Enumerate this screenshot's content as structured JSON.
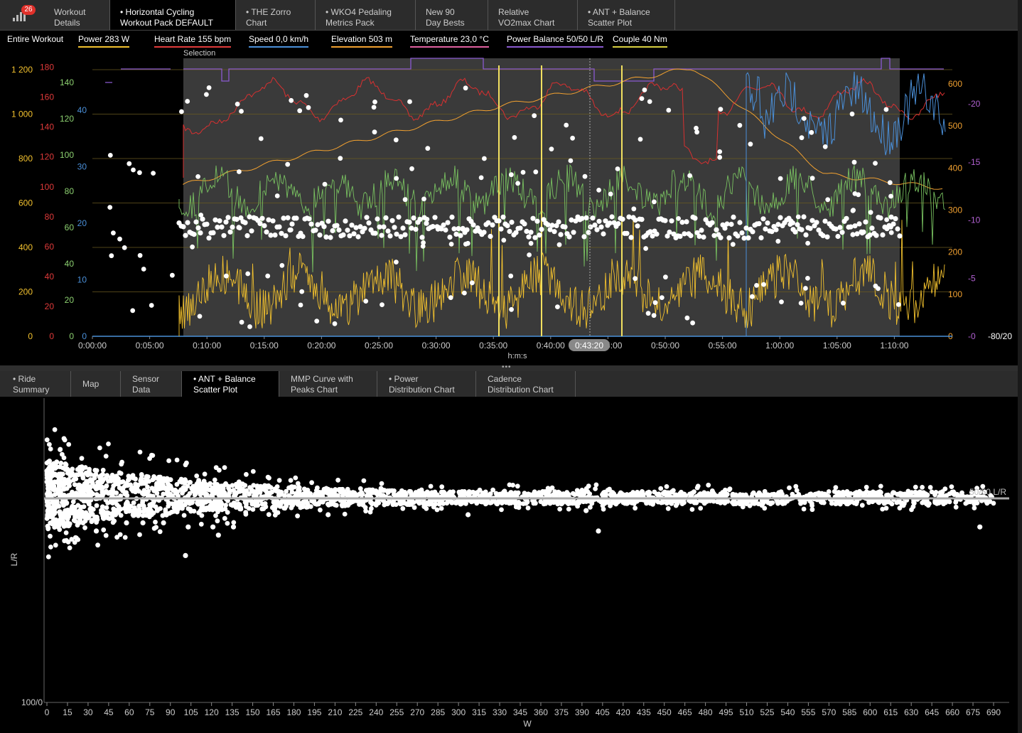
{
  "badge_count": "26",
  "top_tabs": [
    {
      "label": "Workout\nDetails",
      "l1": "Workout",
      "l2": "Details",
      "active": false
    },
    {
      "l1": "• Horizontal Cycling",
      "l2": "Workout Pack DEFAULT",
      "active": true
    },
    {
      "l1": "• THE Zorro",
      "l2": "Chart",
      "active": false
    },
    {
      "l1": "• WKO4 Pedaling",
      "l2": "Metrics Pack",
      "active": false
    },
    {
      "l1": "New 90",
      "l2": "Day Bests",
      "active": false
    },
    {
      "l1": "Relative",
      "l2": "VO2max Chart",
      "active": false
    },
    {
      "l1": "• ANT + Balance",
      "l2": "Scatter Plot",
      "active": false
    }
  ],
  "metrics": {
    "range_label": "Entire Workout",
    "power": "Power  283 W",
    "heart_rate": "Heart Rate  155 bpm",
    "speed": "Speed  0,0 km/h",
    "elevation": "Elevation  503 m",
    "temperature": "Temperature  23,0 °C",
    "power_balance": "Power Balance  50/50 L/R",
    "couple": "Couple  40 Nm"
  },
  "colors": {
    "power": "#f2c12e",
    "heart_rate": "#e03a3a",
    "speed": "#4a8fd8",
    "elevation": "#f0a030",
    "temperature": "#e060a0",
    "power_balance": "#8a5ad0",
    "couple": "#8cd070",
    "selection": "#3a3a3a"
  },
  "top_chart": {
    "selection_label": "Selection",
    "cursor_time": "0:43:20",
    "xlabel": "h:m:s",
    "x_ticks": [
      "0:00:00",
      "0:05:00",
      "0:10:00",
      "0:15:00",
      "0:20:00",
      "0:25:00",
      "0:30:00",
      "0:35:00",
      "0:40:00",
      "0:45:00",
      "0:50:00",
      "0:55:00",
      "1:00:00",
      "1:05:00",
      "1:10:00"
    ],
    "axis_power_ticks": [
      "0",
      "200",
      "400",
      "600",
      "800",
      "1 000",
      "1 200"
    ],
    "axis_hr_ticks": [
      "0",
      "20",
      "40",
      "60",
      "80",
      "100",
      "120",
      "140",
      "160",
      "180"
    ],
    "axis_couple_ticks": [
      "0",
      "20",
      "40",
      "60",
      "80",
      "100",
      "120",
      "140"
    ],
    "axis_speed_ticks": [
      "0",
      "10",
      "20",
      "30",
      "40"
    ],
    "axis_right_elev_ticks": [
      "0",
      "100",
      "200",
      "300",
      "400",
      "500",
      "600"
    ],
    "axis_right_bal_ticks": [
      "0",
      "5",
      "10",
      "15",
      "20"
    ],
    "axis_right_bal_labels": [
      "-0",
      "-5",
      "-10",
      "-15",
      "-20"
    ],
    "axis_far_right": "-80/20"
  },
  "bottom_tabs": [
    {
      "l1": "• Ride",
      "l2": "Summary",
      "active": false
    },
    {
      "l1": "Map",
      "l2": "",
      "active": false
    },
    {
      "l1": "Sensor",
      "l2": "Data",
      "active": false
    },
    {
      "l1": "• ANT + Balance",
      "l2": "Scatter Plot",
      "active": true
    },
    {
      "l1": "MMP Curve with",
      "l2": "Peaks Chart",
      "active": false
    },
    {
      "l1": "• Power",
      "l2": "Distribution Chart",
      "active": false
    },
    {
      "l1": "Cadence",
      "l2": "Distribution Chart",
      "active": false
    }
  ],
  "chart_data": {
    "type": "scatter",
    "title": "",
    "xlabel": "W",
    "ylabel": "L/R",
    "xlim": [
      0,
      690
    ],
    "x_ticks": [
      0,
      15,
      30,
      45,
      60,
      75,
      90,
      105,
      120,
      135,
      150,
      165,
      180,
      195,
      210,
      225,
      240,
      255,
      270,
      285,
      300,
      315,
      330,
      345,
      360,
      375,
      390,
      405,
      420,
      435,
      450,
      465,
      480,
      495,
      510,
      525,
      540,
      555,
      570,
      585,
      600,
      615,
      630,
      645,
      660,
      675,
      690
    ],
    "y_bottom_label": "100/0",
    "reference_line_label": "50/50 L/R",
    "reference_value": 50,
    "outliers": [
      {
        "x": 3,
        "y": 54
      },
      {
        "x": 5,
        "y": 53
      },
      {
        "x": 10,
        "y": 51
      },
      {
        "x": 27,
        "y": 51
      },
      {
        "x": 15,
        "y": 44
      },
      {
        "x": 32,
        "y": 47
      },
      {
        "x": 36,
        "y": 42
      },
      {
        "x": 50,
        "y": 46
      },
      {
        "x": 58,
        "y": 44
      },
      {
        "x": 70,
        "y": 44
      },
      {
        "x": 85,
        "y": 44
      },
      {
        "x": 101,
        "y": 36
      },
      {
        "x": 103,
        "y": 43
      },
      {
        "x": 121,
        "y": 43
      },
      {
        "x": 125,
        "y": 41
      },
      {
        "x": 136,
        "y": 43
      },
      {
        "x": 155,
        "y": 52
      },
      {
        "x": 166,
        "y": 47
      },
      {
        "x": 205,
        "y": 46
      },
      {
        "x": 230,
        "y": 51
      },
      {
        "x": 275,
        "y": 48
      },
      {
        "x": 307,
        "y": 46
      },
      {
        "x": 393,
        "y": 47
      },
      {
        "x": 402,
        "y": 42
      },
      {
        "x": 453,
        "y": 51
      },
      {
        "x": 600,
        "y": 51
      },
      {
        "x": 620,
        "y": 51
      },
      {
        "x": 680,
        "y": 43
      },
      {
        "x": 40,
        "y": 54
      },
      {
        "x": 50,
        "y": 54
      },
      {
        "x": 80,
        "y": 53
      },
      {
        "x": 90,
        "y": 53
      },
      {
        "x": 110,
        "y": 53
      },
      {
        "x": 127,
        "y": 53
      },
      {
        "x": 140,
        "y": 54
      },
      {
        "x": 160,
        "y": 53
      },
      {
        "x": 190,
        "y": 52
      },
      {
        "x": 210,
        "y": 52
      },
      {
        "x": 245,
        "y": 52
      },
      {
        "x": 270,
        "y": 51
      },
      {
        "x": 290,
        "y": 51
      },
      {
        "x": 330,
        "y": 51
      },
      {
        "x": 360,
        "y": 51
      },
      {
        "x": 380,
        "y": 51
      },
      {
        "x": 430,
        "y": 51
      },
      {
        "x": 470,
        "y": 51
      },
      {
        "x": 500,
        "y": 51
      },
      {
        "x": 530,
        "y": 51
      },
      {
        "x": 560,
        "y": 51
      },
      {
        "x": 590,
        "y": 49
      },
      {
        "x": 640,
        "y": 49
      },
      {
        "x": 655,
        "y": 49
      }
    ]
  }
}
